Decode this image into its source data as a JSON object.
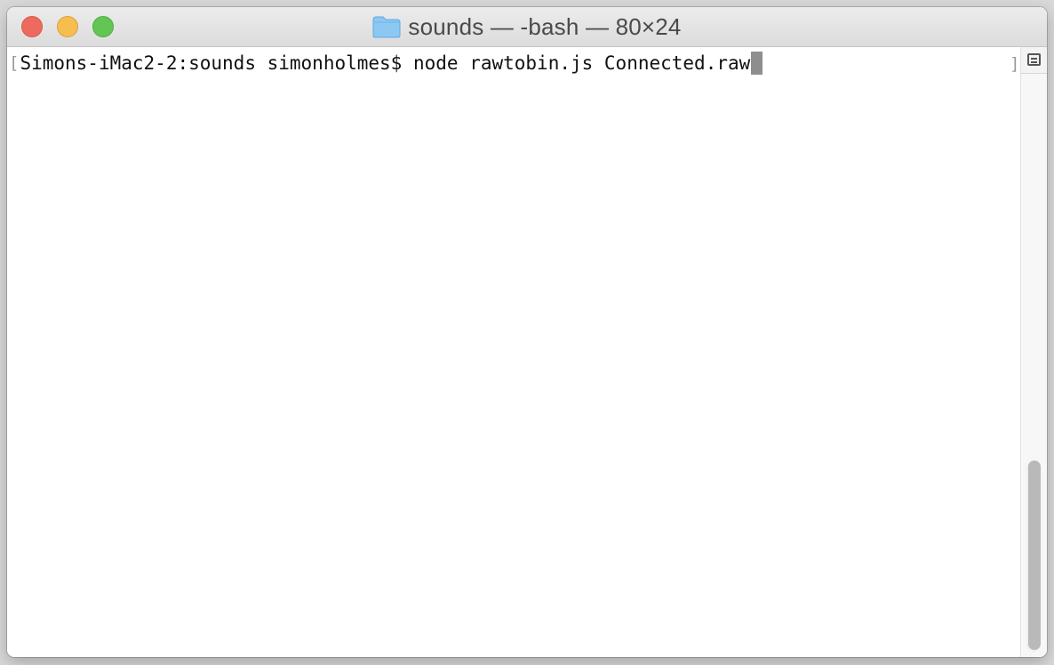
{
  "window": {
    "title": "sounds — -bash — 80×24",
    "title_icon": "folder-icon",
    "buttons": {
      "close": "close-icon",
      "minimize": "minimize-icon",
      "zoom": "zoom-icon"
    }
  },
  "terminal": {
    "prompt": "Simons-iMac2-2:sounds simonholmes$",
    "command": "node rawtobin.js Connected.raw",
    "left_marker": "[",
    "right_marker": "]",
    "cursor": "block-cursor"
  },
  "scroll": {
    "split_icon": "split-pane-icon",
    "thumb_icon": "scrollbar-thumb",
    "position": 1
  },
  "colors": {
    "close": "#ee6a5f",
    "minimize": "#f5be4f",
    "zoom": "#62c554",
    "folder": "#8cc8f2",
    "cursor": "#8e8e8e"
  }
}
